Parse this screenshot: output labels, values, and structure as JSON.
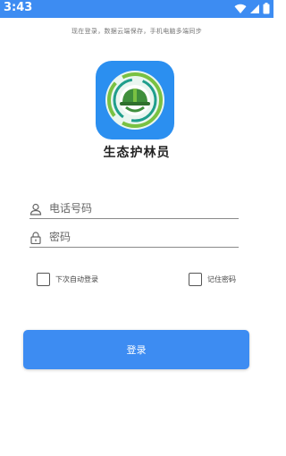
{
  "status_bar": {
    "time": "3:43",
    "icons": [
      "wifi-icon",
      "signal-icon",
      "battery-icon"
    ],
    "background": "#3d8cf2"
  },
  "tagline": "现在登录，数据云端保存，手机电脑多端同步",
  "app": {
    "name": "生态护林员",
    "logo_icon": "ranger-helmet-logo-icon"
  },
  "form": {
    "phone": {
      "placeholder": "电话号码",
      "value": "",
      "icon": "user-icon"
    },
    "password": {
      "placeholder": "密码",
      "value": "",
      "icon": "lock-icon"
    },
    "auto_login": {
      "label": "下次自动登录",
      "checked": false
    },
    "remember_password": {
      "label": "记住密码",
      "checked": false
    }
  },
  "login_button": {
    "label": "登录",
    "color": "#3d8cf2"
  }
}
